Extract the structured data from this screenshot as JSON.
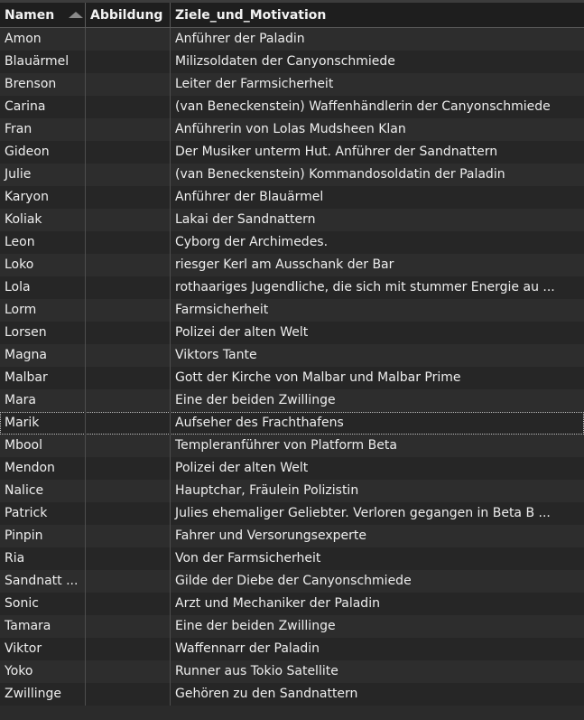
{
  "columns": {
    "namen": "Namen",
    "abbildung": "Abbildung",
    "ziele": "Ziele_und_Motivation"
  },
  "sort": {
    "column": "Namen",
    "direction": "ascending",
    "indicator": "triangle-up-icon"
  },
  "colors": {
    "background": "#2b2b2b",
    "header": "#1e1e1e",
    "row_odd": "#2d2d2d",
    "row_even": "#262626",
    "text": "#eeeeee"
  },
  "rows": [
    {
      "name": "Amon",
      "abbildung": "",
      "ziele": "Anführer der Paladin"
    },
    {
      "name": "Blauärmel",
      "abbildung": "",
      "ziele": "Milizsoldaten der Canyonschmiede"
    },
    {
      "name": "Brenson",
      "abbildung": "",
      "ziele": "Leiter der Farmsicherheit"
    },
    {
      "name": "Carina",
      "abbildung": "",
      "ziele": "(van Beneckenstein) Waffenhändlerin der Canyonschmiede"
    },
    {
      "name": "Fran",
      "abbildung": "",
      "ziele": "Anführerin von Lolas Mudsheen Klan"
    },
    {
      "name": "Gideon",
      "abbildung": "",
      "ziele": "Der Musiker unterm Hut. Anführer der Sandnattern"
    },
    {
      "name": "Julie",
      "abbildung": "",
      "ziele": "(van Beneckenstein) Kommandosoldatin der Paladin"
    },
    {
      "name": "Karyon",
      "abbildung": "",
      "ziele": "Anführer der Blauärmel"
    },
    {
      "name": "Koliak",
      "abbildung": "",
      "ziele": "Lakai der Sandnattern"
    },
    {
      "name": "Leon",
      "abbildung": "",
      "ziele": "Cyborg der Archimedes."
    },
    {
      "name": "Loko",
      "abbildung": "",
      "ziele": "riesger Kerl am Ausschank der Bar"
    },
    {
      "name": "Lola",
      "abbildung": "",
      "ziele": "rothaariges Jugendliche, die sich mit stummer Energie au ..."
    },
    {
      "name": "Lorm",
      "abbildung": "",
      "ziele": "Farmsicherheit"
    },
    {
      "name": "Lorsen",
      "abbildung": "",
      "ziele": "Polizei der alten Welt"
    },
    {
      "name": "Magna",
      "abbildung": "",
      "ziele": "Viktors Tante"
    },
    {
      "name": "Malbar",
      "abbildung": "",
      "ziele": "Gott der Kirche von Malbar und Malbar Prime"
    },
    {
      "name": "Mara",
      "abbildung": "",
      "ziele": "Eine der beiden Zwillinge"
    },
    {
      "name": "Marik",
      "abbildung": "",
      "ziele": "Aufseher des Frachthafens",
      "selected": true
    },
    {
      "name": "Mbool",
      "abbildung": "",
      "ziele": "Templeranführer von Platform Beta"
    },
    {
      "name": "Mendon",
      "abbildung": "",
      "ziele": "Polizei der alten Welt"
    },
    {
      "name": "Nalice",
      "abbildung": "",
      "ziele": "Hauptchar, Fräulein Polizistin"
    },
    {
      "name": "Patrick",
      "abbildung": "",
      "ziele": "Julies ehemaliger Geliebter. Verloren gegangen in Beta B ..."
    },
    {
      "name": "Pinpin",
      "abbildung": "",
      "ziele": "Fahrer und Versorungsexperte"
    },
    {
      "name": "Ria",
      "abbildung": "",
      "ziele": "Von der Farmsicherheit"
    },
    {
      "name": "Sandnatt ...",
      "abbildung": "",
      "ziele": "Gilde der Diebe der Canyonschmiede"
    },
    {
      "name": "Sonic",
      "abbildung": "",
      "ziele": "Arzt und Mechaniker der Paladin"
    },
    {
      "name": "Tamara",
      "abbildung": "",
      "ziele": "Eine der beiden Zwillinge"
    },
    {
      "name": "Viktor",
      "abbildung": "",
      "ziele": "Waffennarr der Paladin"
    },
    {
      "name": "Yoko",
      "abbildung": "",
      "ziele": "Runner aus Tokio Satellite"
    },
    {
      "name": "Zwillinge",
      "abbildung": "",
      "ziele": "Gehören zu den Sandnattern"
    }
  ]
}
